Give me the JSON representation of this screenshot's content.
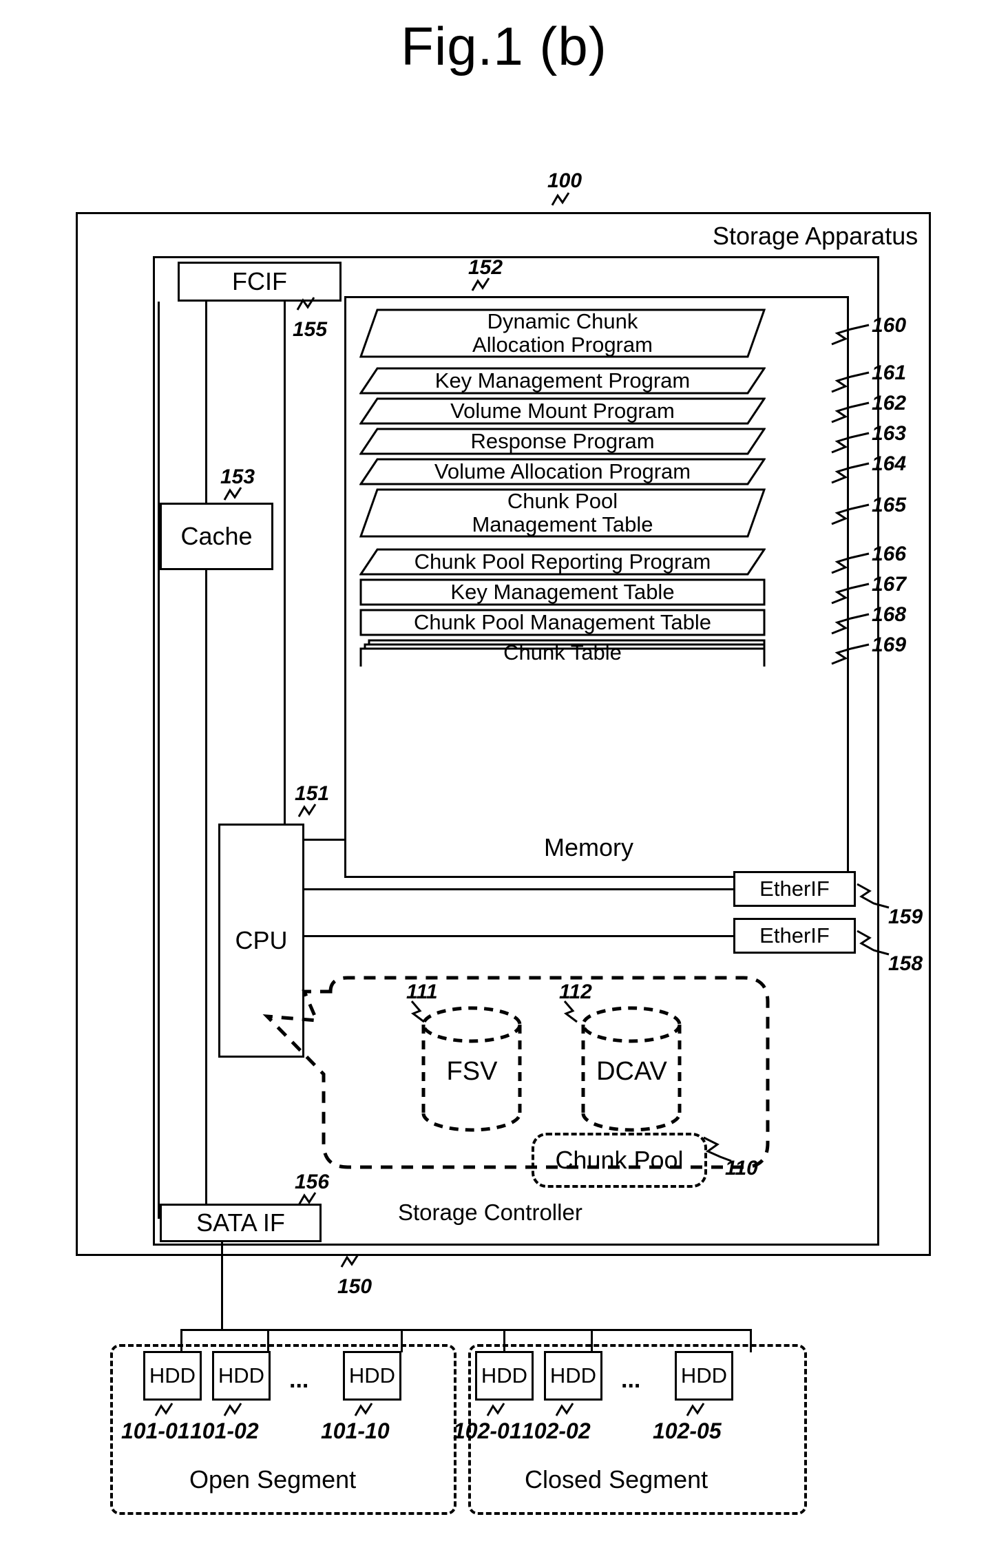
{
  "figure": {
    "title": "Fig.1 (b)",
    "top_ref": "100",
    "apparatus_label": "Storage Apparatus",
    "controller_label": "Storage Controller",
    "memory_label": "Memory"
  },
  "interfaces": {
    "fcif": {
      "label": "FCIF",
      "ref": "155"
    },
    "cache": {
      "label": "Cache",
      "ref": "153"
    },
    "cpu": {
      "label": "CPU",
      "ref": "151"
    },
    "sata": {
      "label": "SATA IF",
      "ref": "156"
    },
    "ether_top": {
      "label": "EtherIF",
      "ref": "159"
    },
    "ether_bottom": {
      "label": "EtherIF",
      "ref": "158"
    },
    "memory_ref": "152",
    "bus_ref": "150"
  },
  "memory_items": [
    {
      "label": "Dynamic Chunk\nAllocation Program",
      "line1": "Dynamic Chunk",
      "line2": "Allocation Program",
      "ref": "160",
      "shape": "parallelogram",
      "lines": 2
    },
    {
      "label": "Key Management Program",
      "line1": "Key Management Program",
      "line2": "",
      "ref": "161",
      "shape": "parallelogram",
      "lines": 1
    },
    {
      "label": "Volume Mount Program",
      "line1": "Volume Mount Program",
      "line2": "",
      "ref": "162",
      "shape": "parallelogram",
      "lines": 1
    },
    {
      "label": "Response Program",
      "line1": "Response Program",
      "line2": "",
      "ref": "163",
      "shape": "parallelogram",
      "lines": 1
    },
    {
      "label": "Volume Allocation Program",
      "line1": "Volume Allocation Program",
      "line2": "",
      "ref": "164",
      "shape": "parallelogram",
      "lines": 1
    },
    {
      "label": "Chunk Pool\nManagement Table",
      "line1": "Chunk Pool",
      "line2": "Management Table",
      "ref": "165",
      "shape": "parallelogram",
      "lines": 2
    },
    {
      "label": "Chunk Pool Reporting Program",
      "line1": "Chunk Pool Reporting Program",
      "line2": "",
      "ref": "166",
      "shape": "parallelogram",
      "lines": 1
    },
    {
      "label": "Key Management Table",
      "line1": "Key Management Table",
      "line2": "",
      "ref": "167",
      "shape": "rectangle",
      "lines": 1
    },
    {
      "label": "Chunk Pool Management Table",
      "line1": "Chunk Pool Management Table",
      "line2": "",
      "ref": "168",
      "shape": "rectangle",
      "lines": 1
    },
    {
      "label": "Chunk Table",
      "line1": "Chunk Table",
      "line2": "",
      "ref": "169",
      "shape": "stacked-rectangle",
      "lines": 1
    }
  ],
  "controller_objects": {
    "fsv": {
      "label": "FSV",
      "ref": "111"
    },
    "dcav": {
      "label": "DCAV",
      "ref": "112"
    },
    "chunk_pool": {
      "label": "Chunk Pool",
      "ref": "110"
    }
  },
  "segments": [
    {
      "name": "Open Segment",
      "disks": [
        {
          "label": "HDD",
          "ref": "101-01"
        },
        {
          "label": "HDD",
          "ref": "101-02"
        },
        {
          "label": "HDD",
          "ref": "101-10"
        }
      ],
      "ellipsis": "..."
    },
    {
      "name": "Closed Segment",
      "disks": [
        {
          "label": "HDD",
          "ref": "102-01"
        },
        {
          "label": "HDD",
          "ref": "102-02"
        },
        {
          "label": "HDD",
          "ref": "102-05"
        }
      ],
      "ellipsis": "..."
    }
  ]
}
